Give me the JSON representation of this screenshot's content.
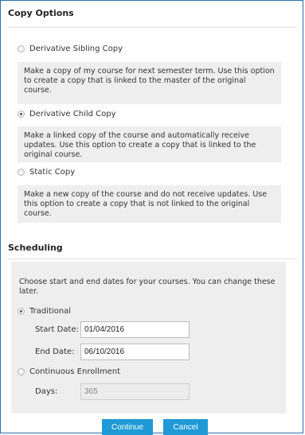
{
  "copy_options": {
    "title": "Copy Options",
    "options": [
      {
        "label": "Derivative Sibling Copy",
        "checked": false,
        "description": "Make a copy of my course for next semester term. Use this option to create a copy that is linked to the master of the original course."
      },
      {
        "label": "Derivative Child Copy",
        "checked": true,
        "description": "Make a linked copy of the course and automatically receive updates. Use this option to create a copy that is linked to the original course."
      },
      {
        "label": "Static Copy",
        "checked": false,
        "description": "Make a new copy of the course and do not receive updates. Use this option to create a copy that is not linked to the original course."
      }
    ]
  },
  "scheduling": {
    "title": "Scheduling",
    "intro": "Choose start and end dates for your courses. You can change these later.",
    "traditional": {
      "label": "Traditional",
      "checked": true,
      "start_label": "Start Date:",
      "start_value": "01/04/2016",
      "end_label": "End Date:",
      "end_value": "06/10/2016"
    },
    "continuous": {
      "label": "Continuous Enrollment",
      "checked": false,
      "days_label": "Days:",
      "days_value": "365"
    }
  },
  "buttons": {
    "continue_label": "Continue",
    "cancel_label": "Cancel"
  },
  "colors": {
    "primary_button": "#1f9ad6",
    "panel_background": "#eeeeee"
  }
}
